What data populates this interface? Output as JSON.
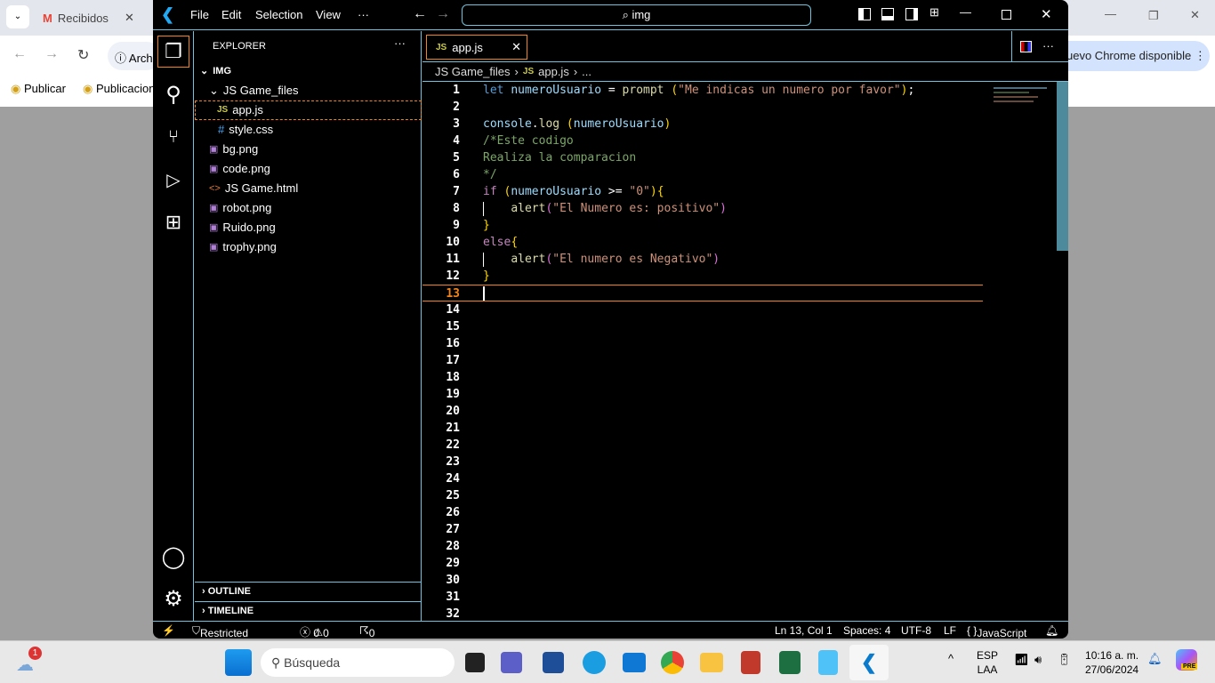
{
  "browser": {
    "tab_title": "Recibidos",
    "address_partial": "Arch",
    "update_banner": "uevo Chrome disponible",
    "bookmarks": [
      "Publicar",
      "Publicacion"
    ]
  },
  "vscode": {
    "menu": [
      "File",
      "Edit",
      "Selection",
      "View",
      "···"
    ],
    "command_center": "img",
    "explorer": {
      "title": "EXPLORER",
      "root": "IMG",
      "folder": "JS Game_files",
      "folder_files": [
        {
          "name": "app.js",
          "icon": "js"
        },
        {
          "name": "style.css",
          "icon": "css"
        }
      ],
      "files": [
        {
          "name": "bg.png",
          "icon": "image"
        },
        {
          "name": "code.png",
          "icon": "image"
        },
        {
          "name": "JS Game.html",
          "icon": "html"
        },
        {
          "name": "robot.png",
          "icon": "image"
        },
        {
          "name": "Ruido.png",
          "icon": "image"
        },
        {
          "name": "trophy.png",
          "icon": "image"
        }
      ],
      "outline": "OUTLINE",
      "timeline": "TIMELINE"
    },
    "tab": {
      "label": "app.js",
      "icon_label": "JS"
    },
    "breadcrumb": [
      "JS Game_files",
      "app.js",
      "..."
    ],
    "code_lines": [
      [
        [
          "let ",
          "kw"
        ],
        [
          "numeroUsuario",
          "vr"
        ],
        [
          " = ",
          "op"
        ],
        [
          "prompt",
          "fn"
        ],
        [
          " (",
          "p1"
        ],
        [
          "\"Me indicas un numero por favor\"",
          "st"
        ],
        [
          ")",
          "p1"
        ],
        [
          ";",
          "op"
        ]
      ],
      [],
      [
        [
          "console",
          "vr"
        ],
        [
          ".",
          "op"
        ],
        [
          "log",
          "fn"
        ],
        [
          " (",
          "p1"
        ],
        [
          "numeroUsuario",
          "vr"
        ],
        [
          ")",
          "p1"
        ]
      ],
      [
        [
          "/*Este codigo",
          "cm"
        ]
      ],
      [
        [
          "Realiza la comparacion",
          "cm"
        ]
      ],
      [
        [
          "*/",
          "cm"
        ]
      ],
      [
        [
          "if ",
          "ctl"
        ],
        [
          "(",
          "p1"
        ],
        [
          "numeroUsuario",
          "vr"
        ],
        [
          " >= ",
          "op"
        ],
        [
          "\"0\"",
          "st"
        ],
        [
          ")",
          "p1"
        ],
        [
          "{",
          "p1"
        ]
      ],
      [
        [
          "    ",
          "op"
        ],
        [
          "alert",
          "fn"
        ],
        [
          "(",
          "p2"
        ],
        [
          "\"El Numero es: positivo\"",
          "st"
        ],
        [
          ")",
          "p2"
        ]
      ],
      [
        [
          "}",
          "p1"
        ]
      ],
      [
        [
          "else",
          "ctl"
        ],
        [
          "{",
          "p1"
        ]
      ],
      [
        [
          "    ",
          "op"
        ],
        [
          "alert",
          "fn"
        ],
        [
          "(",
          "p2"
        ],
        [
          "\"El numero es Negativo\"",
          "st"
        ],
        [
          ")",
          "p2"
        ]
      ],
      [
        [
          "}",
          "p1"
        ]
      ],
      []
    ],
    "total_line_numbers": 32,
    "current_line": 13,
    "status": {
      "restricted": "Restricted Mode",
      "errors": "0",
      "warnings": "0",
      "ports": "0",
      "position": "Ln 13, Col 1",
      "spaces": "Spaces: 4",
      "encoding": "UTF-8",
      "eol": "LF",
      "language": "JavaScript"
    },
    "colors": {
      "border": "#6fc3df",
      "focus": "#f38518"
    }
  },
  "taskbar": {
    "search": "Búsqueda",
    "lang": "ESP",
    "layout": "LAA",
    "time": "10:16 a. m.",
    "date": "27/06/2024",
    "weather_badge": "1",
    "copilot_badge": "PRE"
  }
}
